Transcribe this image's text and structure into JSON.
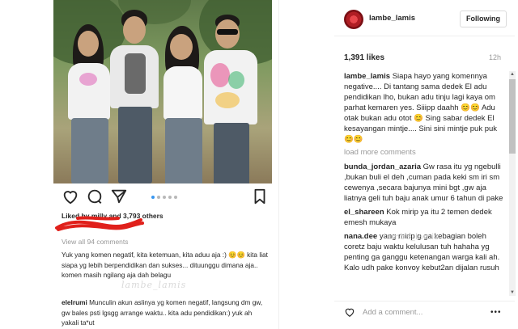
{
  "left": {
    "likes_prefix": "Liked by milly",
    "likes_and": " and 3,793 others",
    "view_all": "View all 94 comments",
    "comments": [
      {
        "user": "",
        "text": "Yuk yang komen negatif, kita ketemuan, kita aduu aja :) 😊😊 kita liat siapa yg lebih berpendidikan dan sukses... dituunggu dimana aja.. komen masih ngilang aja dah belagu"
      },
      {
        "user": "elelrumi",
        "text": "Munculin akun aslinya yg komen negatif, langsung dm gw, gw bales psti lgsgg arrange waktu.. kita adu pendidikan:) yuk ah yakali ta*ut"
      }
    ],
    "watermark": "lambe_lamis",
    "carousel_active": 0,
    "carousel_count": 5
  },
  "post": {
    "username": "lambe_lamis",
    "follow_label": "Following",
    "likes": "1,391 likes",
    "time_ago": "12h",
    "caption_user": "lambe_lamis",
    "caption_text": "Siapa hayo yang komennya negative.... Di tantang sama dedek El adu pendidikan lho, bukan adu tinju lagi kaya om parhat kemaren yes. Siiipp daahh 😊😊 Adu otak bukan adu otot 😊 Sing sabar dedek El kesayangan mintje.... Sini sini mintje puk puk 😊😊",
    "load_more": "load more comments",
    "comments": [
      {
        "user": "bunda_jordan_azaria",
        "text": "Gw rasa itu yg ngebulli ,bukan buli el deh ,cuman pada keki sm iri sm cewenya ,secara bajunya mini bgt ,gw aja liatnya geli tuh baju anak umur 6 tahun di pake"
      },
      {
        "user": "el_shareen",
        "text": "Kok mirip ya itu 2 temen dedek emesh mukaya"
      },
      {
        "user": "nana.dee",
        "text": "yang mirip g ga kebagian boleh coretz baju waktu kelulusan tuh hahaha yg penting ga ganggu ketenangan warga kali ah. Kalo udh pake konvoy kebut2an dijalan rusuh"
      }
    ],
    "watermark": "lambe_lamis",
    "add_comment_placeholder": "Add a comment...",
    "more_label": "•••"
  },
  "icons": {
    "like": "heart-icon",
    "comment": "comment-icon",
    "share": "share-icon",
    "save": "bookmark-icon",
    "more": "more-options-icon"
  },
  "colors": {
    "accent": "#3897f0",
    "scribble": "#e0201b",
    "avatar": "#c4262c"
  }
}
